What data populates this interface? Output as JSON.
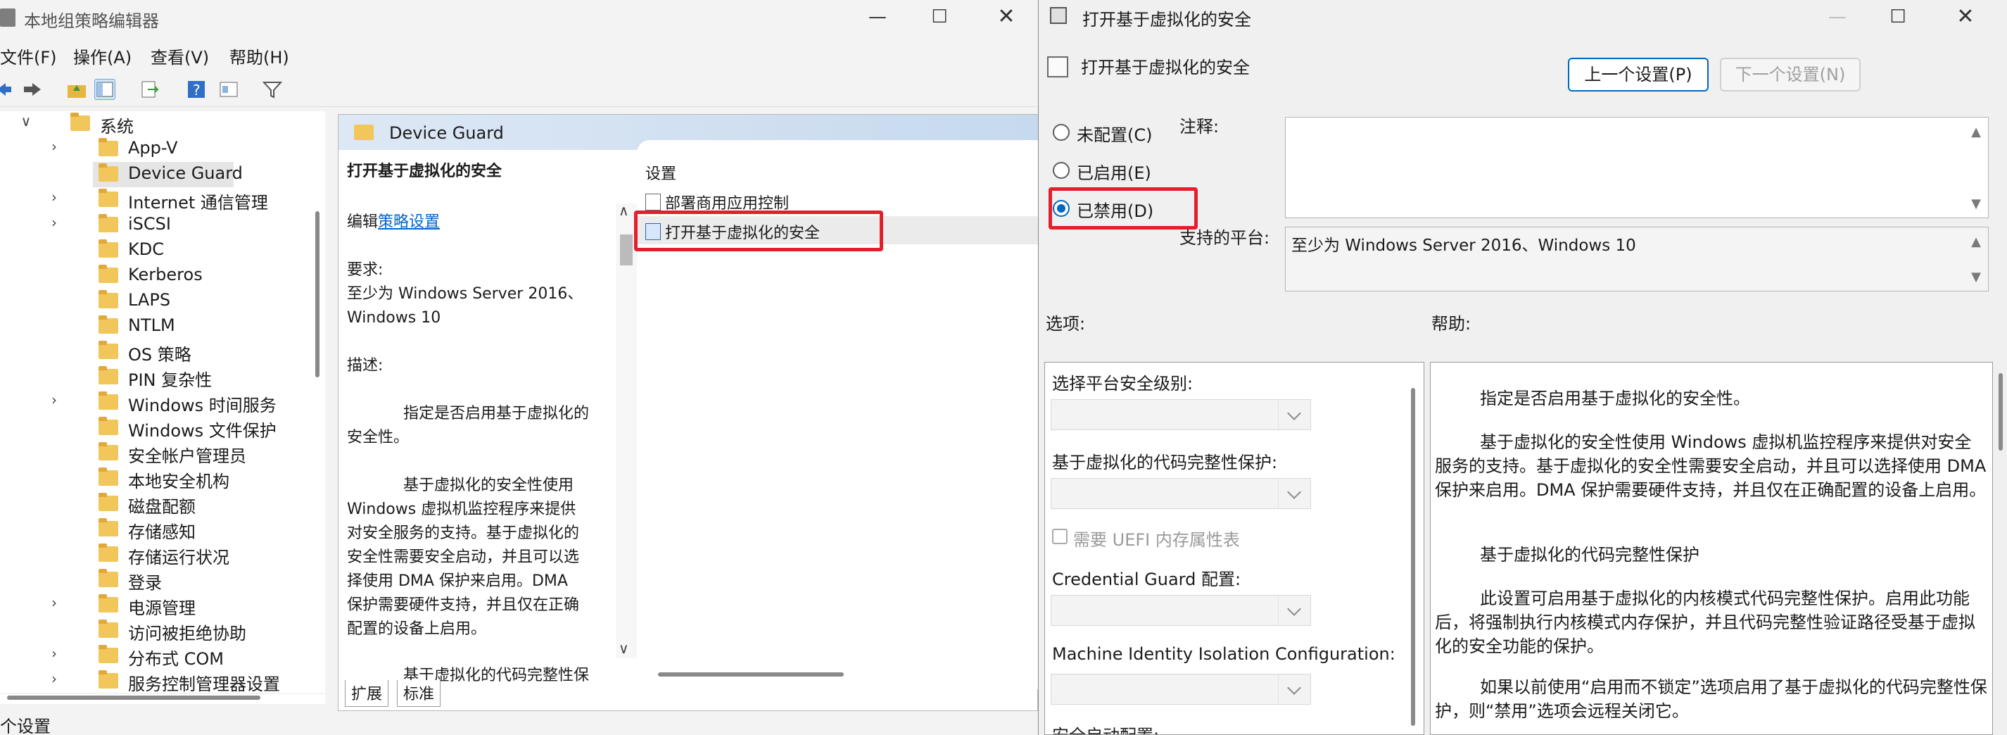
{
  "gpedit": {
    "title": "本地组策略编辑器",
    "menu": [
      "文件(F)",
      "操作(A)",
      "查看(V)",
      "帮助(H)"
    ],
    "tree": [
      {
        "label": "系统",
        "chev": "∨",
        "indent": 0
      },
      {
        "label": "App-V",
        "chev": "›",
        "indent": 1
      },
      {
        "label": "Device Guard",
        "chev": "",
        "indent": 1,
        "selected": true
      },
      {
        "label": "Internet 通信管理",
        "chev": "›",
        "indent": 1
      },
      {
        "label": "iSCSI",
        "chev": "›",
        "indent": 1
      },
      {
        "label": "KDC",
        "chev": "",
        "indent": 1
      },
      {
        "label": "Kerberos",
        "chev": "",
        "indent": 1
      },
      {
        "label": "LAPS",
        "chev": "",
        "indent": 1
      },
      {
        "label": "NTLM",
        "chev": "",
        "indent": 1
      },
      {
        "label": "OS 策略",
        "chev": "",
        "indent": 1
      },
      {
        "label": "PIN 复杂性",
        "chev": "",
        "indent": 1
      },
      {
        "label": "Windows 时间服务",
        "chev": "›",
        "indent": 1
      },
      {
        "label": "Windows 文件保护",
        "chev": "",
        "indent": 1
      },
      {
        "label": "安全帐户管理员",
        "chev": "",
        "indent": 1
      },
      {
        "label": "本地安全机构",
        "chev": "",
        "indent": 1
      },
      {
        "label": "磁盘配额",
        "chev": "",
        "indent": 1
      },
      {
        "label": "存储感知",
        "chev": "",
        "indent": 1
      },
      {
        "label": "存储运行状况",
        "chev": "",
        "indent": 1
      },
      {
        "label": "登录",
        "chev": "",
        "indent": 1
      },
      {
        "label": "电源管理",
        "chev": "›",
        "indent": 1
      },
      {
        "label": "访问被拒绝协助",
        "chev": "",
        "indent": 1
      },
      {
        "label": "分布式 COM",
        "chev": "›",
        "indent": 1
      },
      {
        "label": "服务控制管理器设置",
        "chev": "›",
        "indent": 1
      }
    ],
    "content_header": "Device Guard",
    "desc": {
      "title": "打开基于虚拟化的安全",
      "edit_prefix": "编辑",
      "edit_link": "策略设置",
      "req_label": "要求:",
      "req_line1": "至少为 Windows Server 2016、",
      "req_line2": "Windows 10",
      "desc_label": "描述:",
      "para1_l1": "指定是否启用基于虚拟化的",
      "para1_l2": "安全性。",
      "para2_l1": "基于虚拟化的安全性使用",
      "para2_l2": "Windows 虚拟机监控程序来提供",
      "para2_l3": "对安全服务的支持。基于虚拟化的",
      "para2_l4": "安全性需要安全启动，并且可以选",
      "para2_l5": "择使用 DMA 保护来启用。DMA",
      "para2_l6": "保护需要硬件支持，并且仅在正确",
      "para2_l7": "配置的设备上启用。",
      "para3_l1": "基于虚拟化的代码完整性保"
    },
    "list_header": "设置",
    "list_items": [
      "部署商用应用控制",
      "打开基于虚拟化的安全"
    ],
    "tabs": [
      "扩展",
      "标准"
    ],
    "status": "个设置"
  },
  "dialog": {
    "title": "打开基于虚拟化的安全",
    "subtitle": "打开基于虚拟化的安全",
    "prev_btn": "上一个设置(P)",
    "next_btn": "下一个设置(N)",
    "radio_unconfigured": "未配置(C)",
    "radio_enabled": "已启用(E)",
    "radio_disabled": "已禁用(D)",
    "selected": "disabled",
    "comment_label": "注释:",
    "platform_label": "支持的平台:",
    "platform_value": "至少为 Windows Server 2016、Windows 10",
    "options_label": "选项:",
    "help_label": "帮助:",
    "options": {
      "platform_level": "选择平台安全级别:",
      "code_integrity": "基于虚拟化的代码完整性保护:",
      "uefi_mat": "需要 UEFI 内存属性表",
      "credential_guard": "Credential Guard 配置:",
      "machine_identity": "Machine Identity Isolation Configuration:",
      "secure_launch": "安全启动配置:"
    },
    "help": {
      "p1": "指定是否启用基于虚拟化的安全性。",
      "p2": "基于虚拟化的安全性使用 Windows 虚拟机监控程序来提供对安全服务的支持。基于虚拟化的安全性需要安全启动，并且可以选择使用 DMA 保护来启用。DMA 保护需要硬件支持，并且仅在正确配置的设备上启用。",
      "p3": "基于虚拟化的代码完整性保护",
      "p4": "此设置可启用基于虚拟化的内核模式代码完整性保护。启用此功能后，将强制执行内核模式内存保护，并且代码完整性验证路径受基于虚拟化的安全功能的保护。",
      "p5": "如果以前使用“启用而不锁定”选项启用了基于虚拟化的代码完整性保护，则“禁用”选项会远程关闭它。"
    }
  },
  "colors": {
    "accent": "#0067c0",
    "highlight_box": "#e2202b",
    "folder": "#f1c65a"
  }
}
